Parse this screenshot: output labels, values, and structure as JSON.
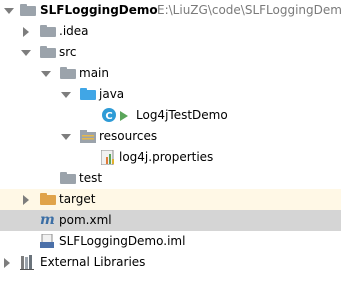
{
  "tree": {
    "root": {
      "name": "SLFLoggingDemo",
      "path": "E:\\LiuZG\\code\\SLFLoggingDemo"
    },
    "idea": ".idea",
    "src": "src",
    "main": "main",
    "java": "java",
    "test_class": "Log4jTestDemo",
    "resources": "resources",
    "properties_file": "log4j.properties",
    "test": "test",
    "target": "target",
    "pom": "pom.xml",
    "iml": "SLFLoggingDemo.iml",
    "external_libraries": "External Libraries"
  },
  "icons": {
    "folder": "folder-icon",
    "java_source_folder": "java-source-folder-icon",
    "resources_folder": "resources-folder-icon",
    "class": "java-class-icon",
    "properties": "properties-file-icon",
    "maven": "maven-icon",
    "module": "module-file-icon",
    "libraries": "library-icon"
  },
  "colors": {
    "folder": "#9ba3ab",
    "source_folder": "#40a6e6",
    "excluded_folder": "#e0a34a",
    "selection": "#d5d5d5"
  }
}
